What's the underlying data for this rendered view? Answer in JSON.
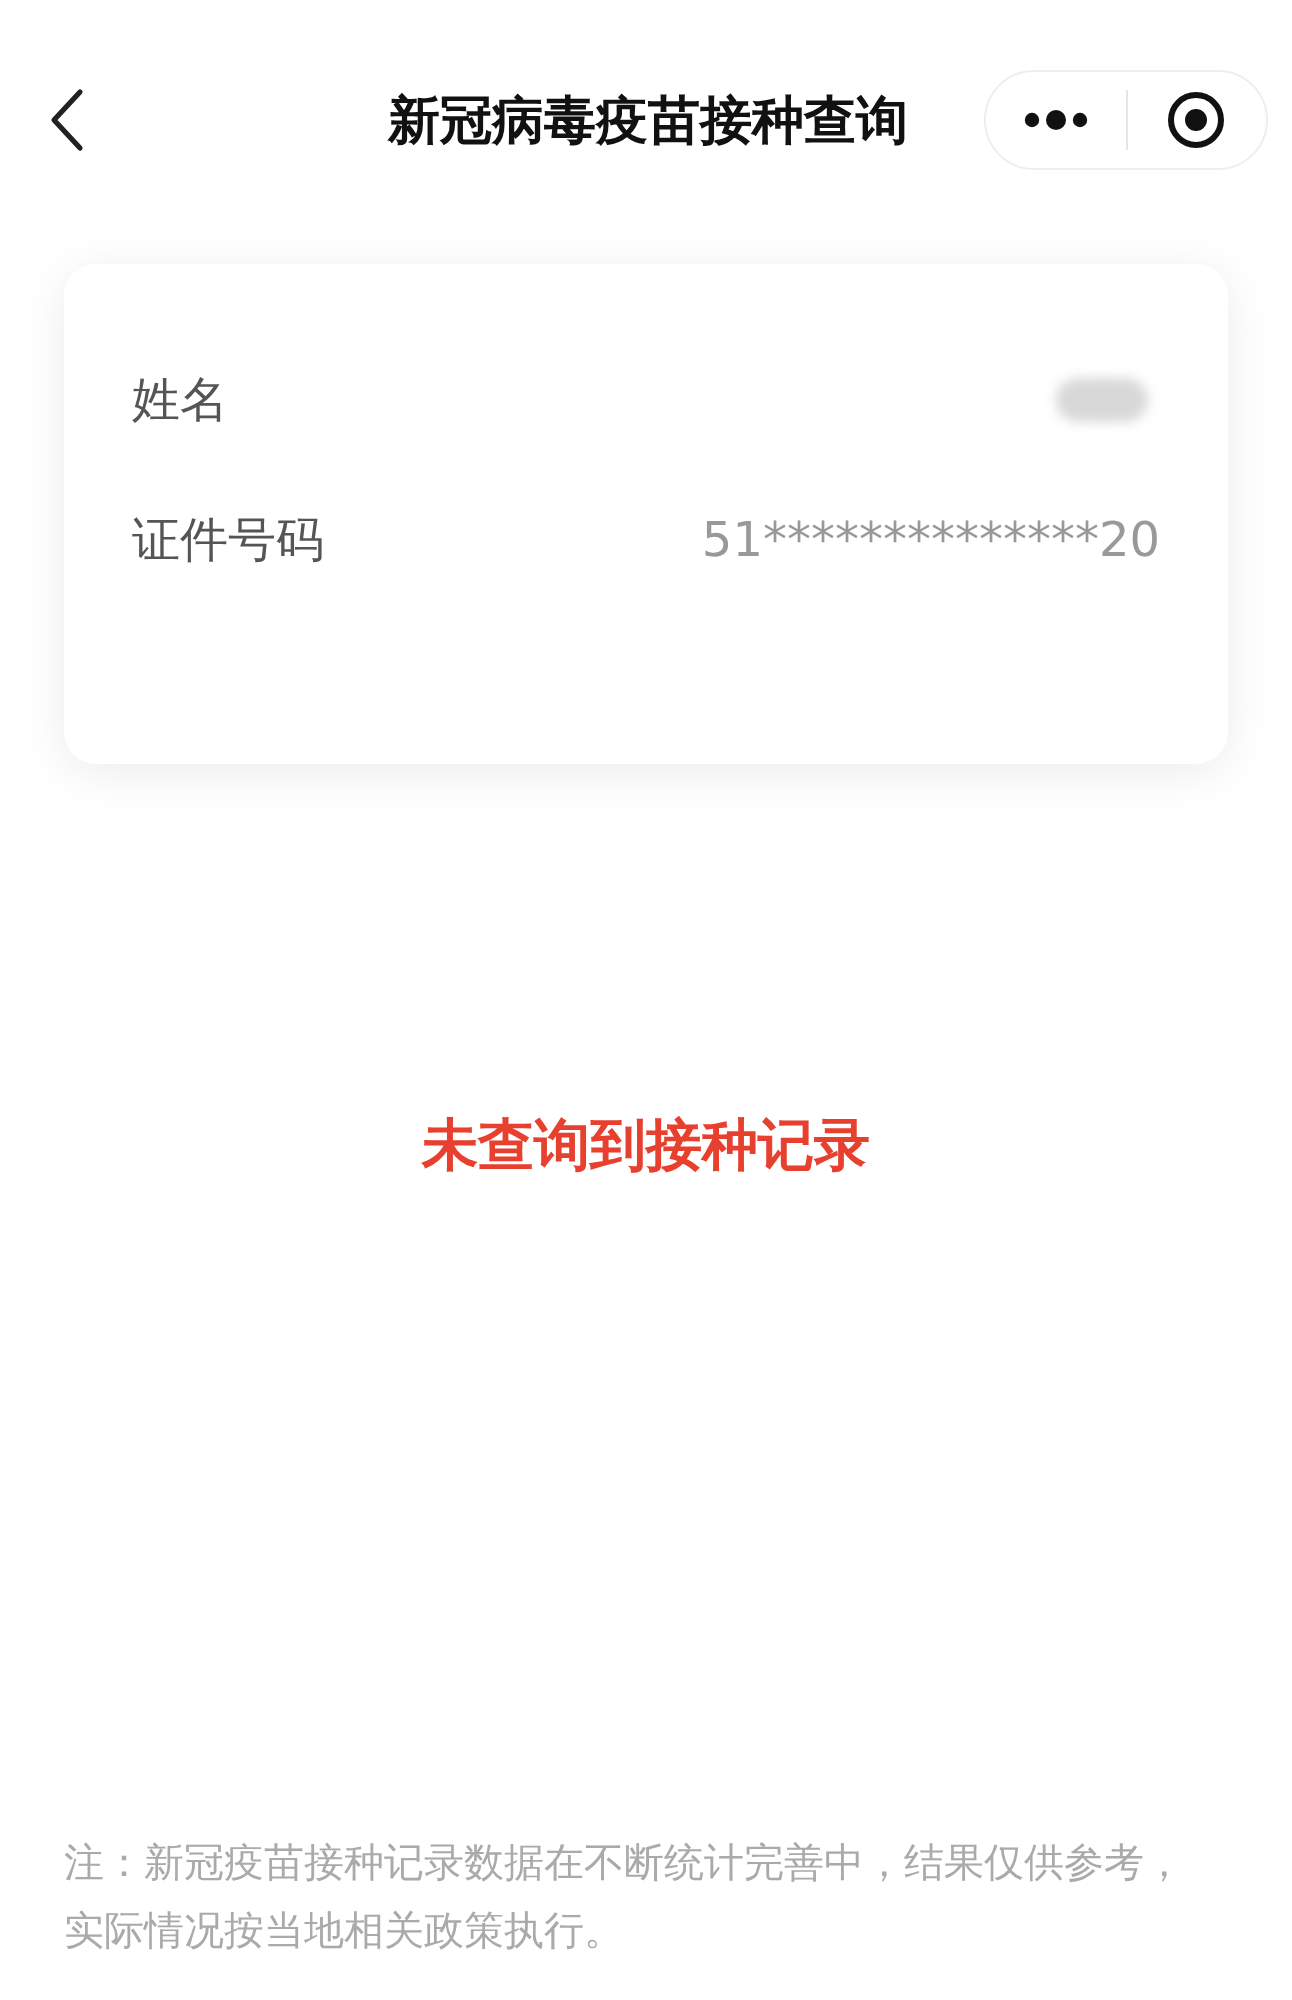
{
  "nav": {
    "title": "新冠病毒疫苗接种查询"
  },
  "info_rows": [
    {
      "label": "姓名",
      "kind": "redacted"
    },
    {
      "label": "证件号码",
      "kind": "text",
      "value": "51**************20"
    }
  ],
  "empty_message": "未查询到接种记录",
  "footnote": "注：新冠疫苗接种记录数据在不断统计完善中，结果仅供参考，实际情况按当地相关政策执行。"
}
